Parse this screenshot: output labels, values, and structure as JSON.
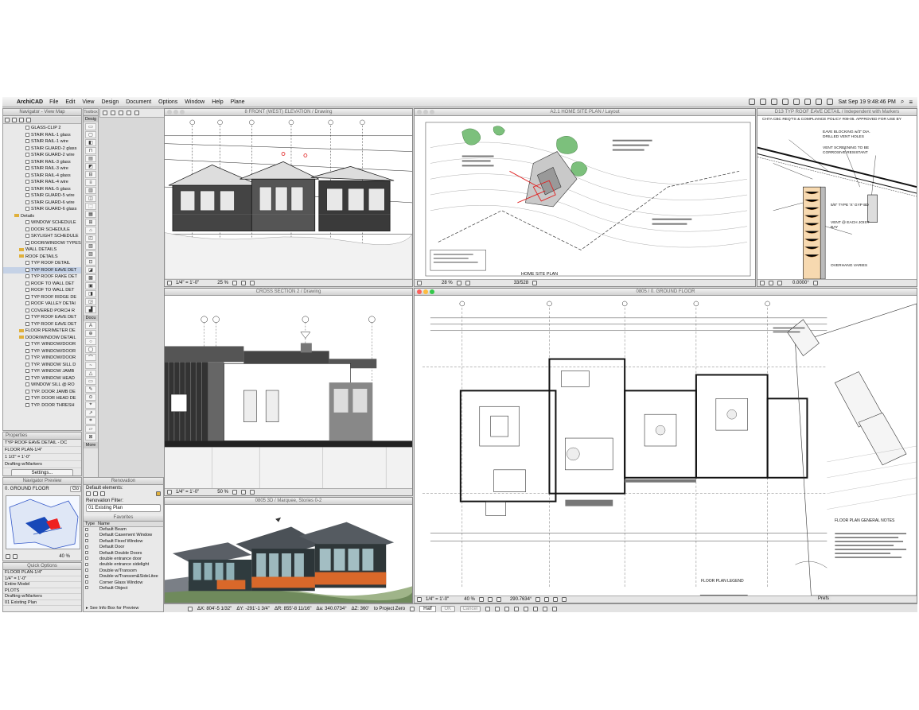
{
  "menubar": {
    "app_name": "ArchiCAD",
    "items": [
      "File",
      "Edit",
      "View",
      "Design",
      "Document",
      "Options",
      "Window",
      "Help",
      "Plane"
    ],
    "clock": "Sat Sep 19  9:48:46 PM"
  },
  "navigator": {
    "title": "Navigator - View Map",
    "items": [
      {
        "label": "GLASS-CLIP 2",
        "type": "item"
      },
      {
        "label": "STAIR RAIL-1 glass",
        "type": "item"
      },
      {
        "label": "STAIR RAIL-1 wire",
        "type": "item"
      },
      {
        "label": "STAIR GUARD-2 glass",
        "type": "item"
      },
      {
        "label": "STAIR GUARD-2 wire",
        "type": "item"
      },
      {
        "label": "STAIR RAIL-3 glass",
        "type": "item"
      },
      {
        "label": "STAIR RAIL-3 wire",
        "type": "item"
      },
      {
        "label": "STAIR RAIL-4 glass",
        "type": "item"
      },
      {
        "label": "STAIR RAIL-4 wire",
        "type": "item"
      },
      {
        "label": "STAIR RAIL-5 glass",
        "type": "item"
      },
      {
        "label": "STAIR GUARD-5 wire",
        "type": "item"
      },
      {
        "label": "STAIR GUARD-6 wire",
        "type": "item"
      },
      {
        "label": "STAIR GUARD-6 glass",
        "type": "item"
      },
      {
        "label": "Details",
        "type": "folder"
      },
      {
        "label": "WINDOW SCHEDULE",
        "type": "item"
      },
      {
        "label": "DOOR SCHEDULE",
        "type": "item"
      },
      {
        "label": "SKYLIGHT SCHEDULE",
        "type": "item"
      },
      {
        "label": "DOOR/WINDOW TYPES",
        "type": "item"
      },
      {
        "label": "WALL DETAILS",
        "type": "folder"
      },
      {
        "label": "ROOF DETAILS",
        "type": "folder"
      },
      {
        "label": "TYP ROOF DETAIL",
        "type": "item"
      },
      {
        "label": "TYP ROOF EAVE DET",
        "type": "item",
        "selected": true
      },
      {
        "label": "TYP ROOF RAKE DET",
        "type": "item"
      },
      {
        "label": "ROOF TO WALL DET",
        "type": "item"
      },
      {
        "label": "ROOF TO WALL DET",
        "type": "item"
      },
      {
        "label": "TYP ROOF RIDGE DE",
        "type": "item"
      },
      {
        "label": "ROOF VALLEY DETAI",
        "type": "item"
      },
      {
        "label": "COVERED PORCH R",
        "type": "item"
      },
      {
        "label": "TYP ROOF EAVE DET",
        "type": "item"
      },
      {
        "label": "TYP ROOF EAVE DET",
        "type": "item"
      },
      {
        "label": "FLOOR PERIMETER DE",
        "type": "folder"
      },
      {
        "label": "DOOR/WINDOW DETAIL",
        "type": "folder"
      },
      {
        "label": "TYP. WINDOW/DOOR",
        "type": "item"
      },
      {
        "label": "TYP. WINDOW/DOOR",
        "type": "item"
      },
      {
        "label": "TYP. WINDOW/DOOR",
        "type": "item"
      },
      {
        "label": "TYP. WINDOW SILL D",
        "type": "item"
      },
      {
        "label": "TYP. WINDOW JAMB",
        "type": "item"
      },
      {
        "label": "TYP. WINDOW HEAD",
        "type": "item"
      },
      {
        "label": "WINDOW SILL @ RO",
        "type": "item"
      },
      {
        "label": "TYP. DOOR JAMB DE",
        "type": "item"
      },
      {
        "label": "TYP. DOOR HEAD DE",
        "type": "item"
      },
      {
        "label": "TYP. DOOR THRESH",
        "type": "item"
      }
    ]
  },
  "properties": {
    "title": "Properties",
    "rows": [
      "TYP ROOF EAVE DETAIL - DC",
      "FLOOR PLAN-1/4\"",
      "1 1/2\" =   1'-0\"",
      "Drafting w/Markers"
    ],
    "settings_label": "Settings..."
  },
  "nav_preview": {
    "title": "Navigator Preview",
    "story": "0. GROUND FLOOR",
    "go_label": "Go",
    "zoom": "40 %"
  },
  "quick_options": {
    "title": "Quick Options",
    "rows": [
      "FLOOR PLAN-1/4\"",
      "1/4\"   =   1'-0\"",
      "Entire Model",
      "PLOTS",
      "Drafting w/Markers",
      "01 Existing Plan",
      "PLANS"
    ]
  },
  "toolbox": {
    "tabs": [
      "Toolbox",
      "Desig",
      "Docu",
      "More"
    ],
    "tools": [
      "▭",
      "▢",
      "◧",
      "⊓",
      "▤",
      "◩",
      "⊟",
      "≡",
      "▥",
      "◫",
      "⬚",
      "▦",
      "⊞",
      "⌂",
      "◰",
      "▧",
      "▨",
      "⊡",
      "◪",
      "▩",
      "▣",
      "◨",
      "◲",
      "▟"
    ],
    "doc_tools": [
      "A",
      "⊕",
      "○",
      "◯",
      "⌒",
      "~",
      "△",
      "▭",
      "✎",
      "⊙",
      "⌖",
      "↗",
      "⌗",
      "▱",
      "⊠"
    ]
  },
  "renovation": {
    "title": "Renovation",
    "default_label": "Default elements:",
    "filter_label": "Renovation Filter:",
    "filter_value": "01 Existing Plan",
    "favorites_title": "Favorites",
    "col_type": "Type",
    "col_name": "Name",
    "favorites": [
      "Default Beam",
      "Default Casement Window",
      "Default Fixed Window",
      "Default Door",
      "Default Double Doors",
      "double entrance door",
      "double entrance sidelight",
      "Double w/Transom",
      "Double w/Transom&SideLitee",
      "Corner Glass Window",
      "Default Object"
    ],
    "info_label": "See Info Box for Preview"
  },
  "windows": {
    "elevation": {
      "title": "8 FRONT (WEST) ELEVATION / Drawing",
      "scale": "1/4\"   =   1'-0\"",
      "zoom": "25 %"
    },
    "site": {
      "title": "A2.1 HOME SITE PLAN / Layout",
      "zoom": "28 %",
      "page": "33/528",
      "plan_label": "HOME SITE PLAN"
    },
    "eave": {
      "title": "D13 TYP ROOF EAVE DETAIL / Independent with Markers",
      "zoom": "0.0000°",
      "notes": [
        "CH7A CBC REQ'TS & COMPLIANCE POLICY #09-05. APPROVED FOR USE BY",
        "EAVE BLOCKING w/3\" DIA. DRILLED VENT HOLES",
        "VENT SCREENING TO BE CORROSIVE RESISTANT",
        "5/8\" TYPE 'X' GYP BD",
        "VENT @ EACH JOIST BAY",
        "OVERHANG VARIES"
      ]
    },
    "section": {
      "title": "CROSS SECTION 2 / Drawing",
      "scale": "1/4\"   =   1'-0\"",
      "zoom": "50 %"
    },
    "plan": {
      "title": "0805 / 0. GROUND FLOOR",
      "scale": "1/4\"   =   1'-0\"",
      "zoom": "40 %",
      "angle": "290.7634°",
      "legend": "FLOOR PLAN LEGEND",
      "notes": "FLOOR PLAN GENERAL NOTES"
    },
    "view3d": {
      "title": "0805 3D / Marquee, Stories 0-2"
    }
  },
  "statusbar": {
    "coords": [
      "ΔX: 804'-5 1/32\"",
      "ΔY: -291'-1 3/4\"",
      "ΔR: 855'-8 11/16\"",
      "Δa: 340.0734°",
      "ΔZ: 360'",
      "to Project Zero"
    ],
    "ok_label": "OK",
    "cancel_label": "Cancel",
    "prefs_label": "Prefs",
    "plane_label": "Half"
  },
  "colors": {
    "accent_red": "#e02020",
    "site_green": "#7cc07c",
    "wood_orange": "#d9682a"
  }
}
